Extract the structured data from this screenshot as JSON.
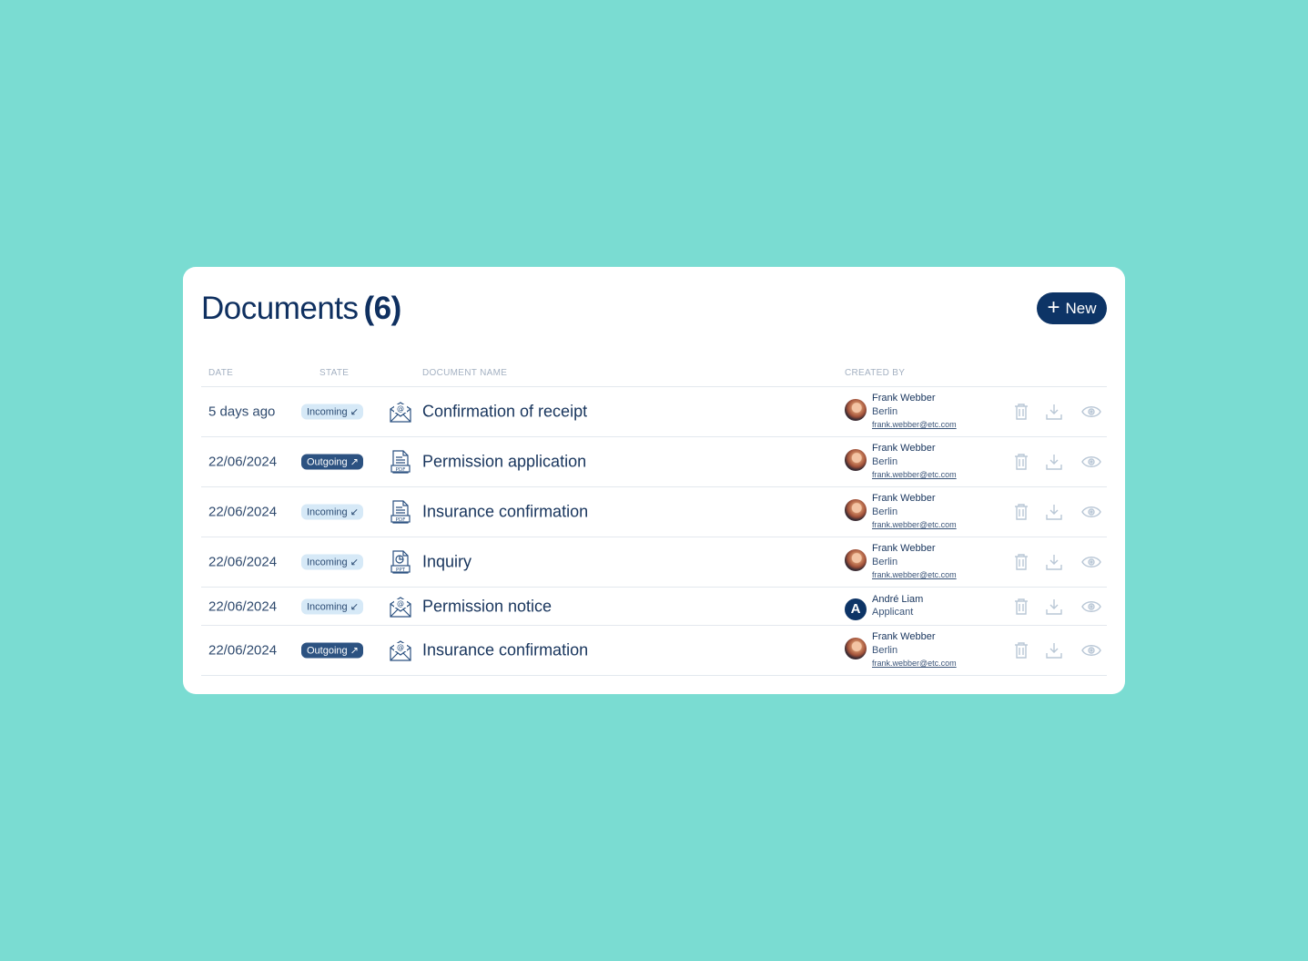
{
  "header": {
    "title": "Documents",
    "count": "(6)",
    "new_button": "New"
  },
  "columns": {
    "date": "DATE",
    "state": "STATE",
    "document_name": "DOCUMENT NAME",
    "created_by": "CREATED BY"
  },
  "rows": [
    {
      "date": "5 days ago",
      "state": "Incoming ↙",
      "state_type": "incoming",
      "file_icon": "email-icon",
      "name": "Confirmation of receipt",
      "creator": {
        "name": "Frank Webber",
        "line2": "Berlin",
        "email": "frank.webber@etc.com"
      }
    },
    {
      "date": "22/06/2024",
      "state": "Outgoing ↗",
      "state_type": "outgoing",
      "file_icon": "pdf-file-icon",
      "name": "Permission application",
      "creator": {
        "name": "Frank Webber",
        "line2": "Berlin",
        "email": "frank.webber@etc.com"
      }
    },
    {
      "date": "22/06/2024",
      "state": "Incoming ↙",
      "state_type": "incoming",
      "file_icon": "pdf-file-icon",
      "name": "Insurance confirmation",
      "creator": {
        "name": "Frank Webber",
        "line2": "Berlin",
        "email": "frank.webber@etc.com"
      }
    },
    {
      "date": "22/06/2024",
      "state": "Incoming ↙",
      "state_type": "incoming",
      "file_icon": "ppt-file-icon",
      "name": "Inquiry",
      "creator": {
        "name": "Frank Webber",
        "line2": "Berlin",
        "email": "frank.webber@etc.com"
      }
    },
    {
      "date": "22/06/2024",
      "state": "Incoming ↙",
      "state_type": "incoming",
      "file_icon": "email-icon",
      "name": "Permission notice",
      "creator": {
        "name": "André Liam",
        "line2": "Applicant",
        "avatar_letter": "A"
      }
    },
    {
      "date": "22/06/2024",
      "state": "Outgoing ↗",
      "state_type": "outgoing",
      "file_icon": "email-icon",
      "name": "Insurance confirmation",
      "creator": {
        "name": "Frank Webber",
        "line2": "Berlin",
        "email": "frank.webber@etc.com"
      }
    }
  ],
  "colors": {
    "background": "#7adcd2",
    "primary": "#0d3466",
    "badge_incoming": "#d6e9f7",
    "badge_outgoing": "#2c5281",
    "action_icon": "#b9c7d6"
  }
}
